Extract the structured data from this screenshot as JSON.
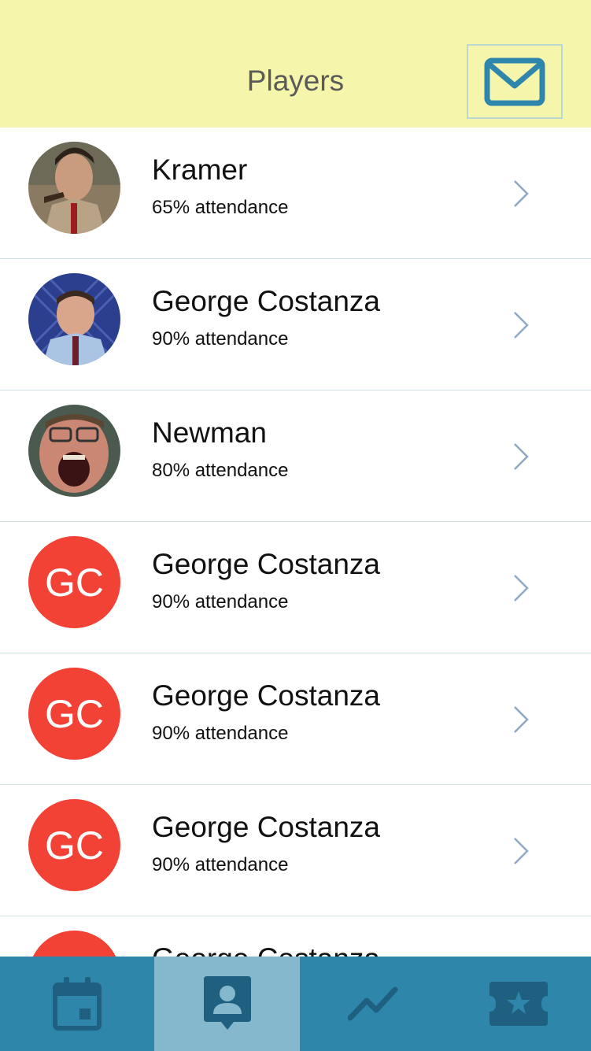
{
  "header": {
    "title": "Players",
    "mail_icon": "envelope-icon"
  },
  "players": [
    {
      "name": "Kramer",
      "attendance": "65% attendance",
      "avatar": "photo",
      "initials": ""
    },
    {
      "name": "George Costanza",
      "attendance": "90% attendance",
      "avatar": "photo",
      "initials": ""
    },
    {
      "name": "Newman",
      "attendance": "80% attendance",
      "avatar": "photo",
      "initials": ""
    },
    {
      "name": "George Costanza",
      "attendance": "90% attendance",
      "avatar": "initials",
      "initials": "GC"
    },
    {
      "name": "George Costanza",
      "attendance": "90% attendance",
      "avatar": "initials",
      "initials": "GC"
    },
    {
      "name": "George Costanza",
      "attendance": "90% attendance",
      "avatar": "initials",
      "initials": "GC"
    },
    {
      "name": "George Costanza",
      "attendance": "",
      "avatar": "initials",
      "initials": ""
    }
  ],
  "tabbar": {
    "tabs": [
      {
        "icon": "calendar-icon",
        "active": false
      },
      {
        "icon": "player-badge-icon",
        "active": true
      },
      {
        "icon": "trend-line-icon",
        "active": false
      },
      {
        "icon": "ticket-star-icon",
        "active": false
      }
    ]
  },
  "colors": {
    "header_bg": "#f5f5ab",
    "accent": "#2e86ab",
    "tab_active": "#85b8cd",
    "initials_bg": "#f24236"
  }
}
